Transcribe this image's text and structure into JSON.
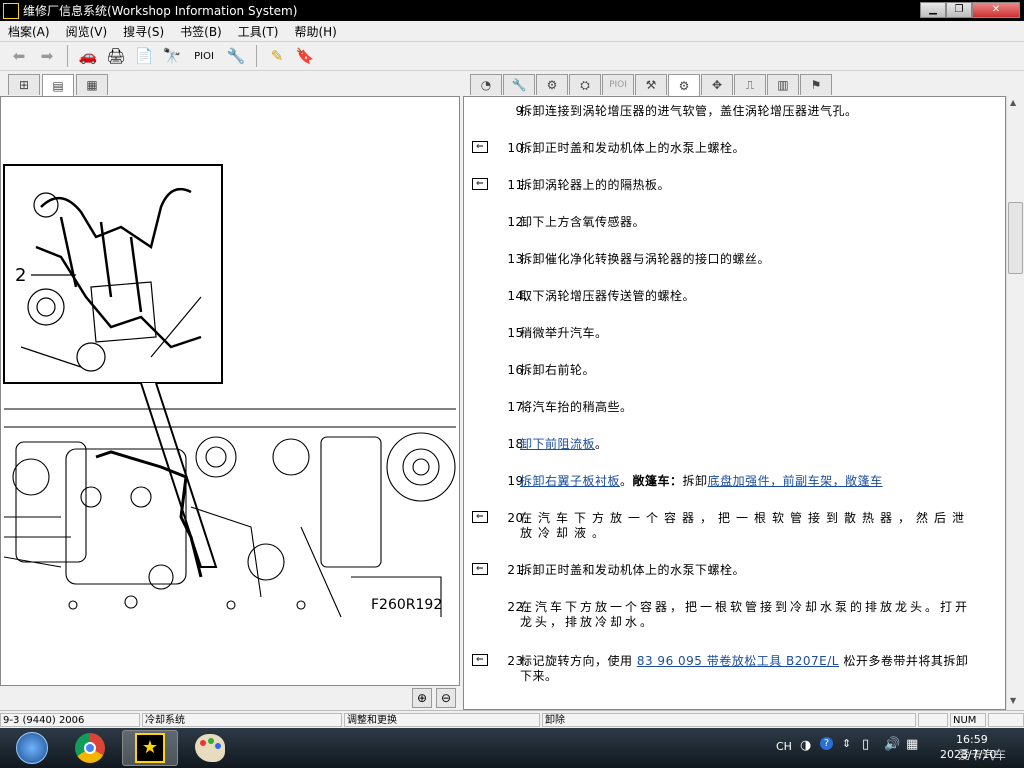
{
  "window": {
    "title": "维修厂信息系统(Workshop Information System)",
    "min": "▁",
    "max": "❐",
    "close": "✕"
  },
  "menu": [
    "档案(A)",
    "阅览(V)",
    "搜寻(S)",
    "书签(B)",
    "工具(T)",
    "帮助(H)"
  ],
  "toolbar": {
    "pioi": "PIOI"
  },
  "right_tabs": {
    "pioi": "PIOI"
  },
  "figure": {
    "callout": "2",
    "label": "F260R192"
  },
  "steps": [
    {
      "num": "9.",
      "marker": false,
      "text": "拆卸连接到涡轮增压器的进气软管，盖住涡轮增压器进气孔。"
    },
    {
      "num": "10.",
      "marker": true,
      "text": "拆卸正时盖和发动机体上的水泵上螺栓。"
    },
    {
      "num": "11.",
      "marker": true,
      "text": "拆卸涡轮器上的的隔热板。"
    },
    {
      "num": "12.",
      "marker": false,
      "text": "卸下上方含氧传感器。"
    },
    {
      "num": "13.",
      "marker": false,
      "text": "拆卸催化净化转换器与涡轮器的接口的螺丝。"
    },
    {
      "num": "14.",
      "marker": false,
      "text": "取下涡轮增压器传送管的螺栓。"
    },
    {
      "num": "15.",
      "marker": false,
      "text": "稍微举升汽车。"
    },
    {
      "num": "16.",
      "marker": false,
      "text": "拆卸右前轮。"
    },
    {
      "num": "17.",
      "marker": false,
      "text": "将汽车抬的稍高些。"
    },
    {
      "num": "18.",
      "marker": false,
      "link": "卸下前阻流板",
      "after": "。"
    },
    {
      "num": "19.",
      "marker": false,
      "link": "拆卸右翼子板衬板",
      "after": "。",
      "bold": "敞篷车：",
      "text2": "拆卸",
      "link2": "底盘加强件，前副车架，敞篷车"
    },
    {
      "num": "20.",
      "marker": true,
      "text": "在汽车下方放一个容器，把一根软管接到散热器，然后泄放冷却液。"
    },
    {
      "num": "21.",
      "marker": true,
      "text": "拆卸正时盖和发动机体上的水泵下螺栓。"
    },
    {
      "num": "22.",
      "marker": false,
      "text": "在汽车下方放一个容器，把一根软管接到冷却水泵的排放龙头。打开龙头，排放冷却水。"
    },
    {
      "num": "23.",
      "marker": true,
      "pre": "标记旋转方向，使用",
      "link": "83 96 095 带卷放松工具 B207E/L",
      "after": "松开多卷带并将其拆卸下来。"
    }
  ],
  "status": {
    "model": "9-3 (9440) 2006",
    "system": "冷却系统",
    "section": "调整和更换",
    "action": "卸除",
    "num": "NUM"
  },
  "taskbar": {
    "lang": "CH",
    "time": "16:59",
    "date": "2023/7/10",
    "watermark": "爱卡汽车"
  }
}
